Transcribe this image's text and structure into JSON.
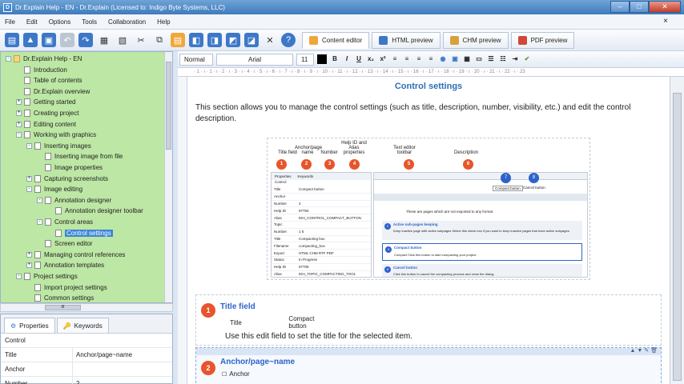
{
  "window": {
    "title": "Dr.Explain Help - EN - Dr.Explain (Licensed to: Indigo Byte Systems, LLC)",
    "buttons": {
      "minimize": "–",
      "maximize": "□",
      "close": "✕"
    }
  },
  "menu": {
    "items": [
      "File",
      "Edit",
      "Options",
      "Tools",
      "Collaboration",
      "Help"
    ],
    "close": "×"
  },
  "toolbar": {
    "tabs": [
      {
        "label": "Content editor",
        "active": true,
        "color": "#f0a73a"
      },
      {
        "label": "HTML preview",
        "active": false,
        "color": "#3d78c8"
      },
      {
        "label": "CHM preview",
        "active": false,
        "color": "#d9a13b"
      },
      {
        "label": "PDF preview",
        "active": false,
        "color": "#d1463a"
      }
    ],
    "help_label": "?"
  },
  "tree": {
    "items": [
      {
        "label": "Dr.Explain Help - EN",
        "level": 0,
        "expander": "-",
        "folder": true
      },
      {
        "label": "Introduction",
        "level": 1,
        "expander": "",
        "folder": false
      },
      {
        "label": "Table of contents",
        "level": 1,
        "expander": "",
        "folder": false
      },
      {
        "label": "Dr.Explain overview",
        "level": 1,
        "expander": "",
        "folder": false
      },
      {
        "label": "Getting started",
        "level": 1,
        "expander": "+",
        "folder": false
      },
      {
        "label": "Creating project",
        "level": 1,
        "expander": "+",
        "folder": false
      },
      {
        "label": "Editing content",
        "level": 1,
        "expander": "+",
        "folder": false
      },
      {
        "label": "Working with graphics",
        "level": 1,
        "expander": "-",
        "folder": false
      },
      {
        "label": "Inserting images",
        "level": 2,
        "expander": "-",
        "folder": false
      },
      {
        "label": "Inserting image from file",
        "level": 3,
        "expander": "",
        "folder": false
      },
      {
        "label": "Image properties",
        "level": 3,
        "expander": "",
        "folder": false
      },
      {
        "label": "Capturing screenshots",
        "level": 2,
        "expander": "+",
        "folder": false
      },
      {
        "label": "Image editing",
        "level": 2,
        "expander": "-",
        "folder": false
      },
      {
        "label": "Annotation designer",
        "level": 3,
        "expander": "-",
        "folder": false
      },
      {
        "label": "Annotation designer toolbar",
        "level": 4,
        "expander": "",
        "folder": false
      },
      {
        "label": "Control areas",
        "level": 3,
        "expander": "-",
        "folder": false
      },
      {
        "label": "Control settings",
        "level": 4,
        "expander": "",
        "folder": false,
        "selected": true
      },
      {
        "label": "Screen editor",
        "level": 3,
        "expander": "",
        "folder": false
      },
      {
        "label": "Managing control references",
        "level": 2,
        "expander": "+",
        "folder": false
      },
      {
        "label": "Annotation templates",
        "level": 2,
        "expander": "+",
        "folder": false
      },
      {
        "label": "Project settings",
        "level": 1,
        "expander": "-",
        "folder": false
      },
      {
        "label": "Import project settings",
        "level": 2,
        "expander": "",
        "folder": false
      },
      {
        "label": "Common settings",
        "level": 2,
        "expander": "",
        "folder": false
      }
    ],
    "hscroll_label": "III"
  },
  "properties": {
    "tabs": [
      "Properties",
      "Keywords"
    ],
    "section": "Control",
    "rows": [
      {
        "key": "Title",
        "value": "Anchor/page~name"
      },
      {
        "key": "Anchor",
        "value": ""
      },
      {
        "key": "Number",
        "value": "2"
      }
    ]
  },
  "format": {
    "style": "Normal",
    "font": "Arial",
    "size": "11",
    "buttons": [
      "B",
      "I",
      "U",
      "x₂",
      "x²"
    ]
  },
  "ruler_text": "· 1 · ı · 1 · ı · 2 · ı · 3 · ı · 4 · ı · 5 · ı · 6 · ı · 7 · ı · 8 · ı · 9 · ı · 10 · ı · 11 · ı · 12 · ı · 13 · ı · 14 · ı · 15 · ı · 16 · ı · 17 · ı · 18 · ı · 19 · ı · 20 · ı · 21 · ı · 22 · ı · 23",
  "content": {
    "heading": "Control settings",
    "intro": "This section allows you to manage the control settings (such as title, description, number, visibility, etc.) and edit the control description.",
    "figure": {
      "callouts": [
        {
          "num": "1",
          "label": "Title field"
        },
        {
          "num": "2",
          "label": "Anchor/page name"
        },
        {
          "num": "3",
          "label": "Number"
        },
        {
          "num": "4",
          "label": "Help ID and Alias properties"
        },
        {
          "num": "5",
          "label": "Text editor toolbar"
        },
        {
          "num": "6",
          "label": "Description"
        }
      ],
      "blue_callouts": [
        {
          "num": "7",
          "label": "Compact button"
        },
        {
          "num": "8",
          "label": "Cancel button"
        }
      ],
      "mini_rows": [
        {
          "k": "Title",
          "v": "Compact button"
        },
        {
          "k": "Anchor",
          "v": ""
        },
        {
          "k": "Number",
          "v": "4"
        },
        {
          "k": "Help ID",
          "v": "97784"
        },
        {
          "k": "Alias",
          "v": "IDH_CONTROL_COMPACT_BUTTON"
        },
        {
          "k": "Topic",
          "v": ""
        },
        {
          "k": "Number",
          "v": "1  5"
        },
        {
          "k": "Title",
          "v": "Compacting box"
        },
        {
          "k": "Filename",
          "v": "compacting_box"
        },
        {
          "k": "Export",
          "v": "HTML  CHM  RTF  PDF"
        },
        {
          "k": "Status",
          "v": "In Progress"
        },
        {
          "k": "Help ID",
          "v": "97706"
        },
        {
          "k": "Alias",
          "v": "IDH_TOPIC_COMPACTING_TOOL"
        }
      ],
      "mini_tabs": [
        "Properties",
        "Keywords"
      ],
      "mini_section": "Control",
      "right_lines": [
        "These are pages which are not exported to any format.",
        "Active sub-pages keeping",
        "Keep inactive page with active subpages   Select this check box if you want to keep inactive pages that have active subpages",
        "Compact button",
        "Compact   Click this button to start compacting your project.",
        "Cancel button",
        "Click this button to cancel the compacting process and close the dialog."
      ],
      "right_nums": [
        "2",
        "4",
        "5"
      ]
    },
    "section1": {
      "num": "1",
      "title": "Title field",
      "field_label": "Title",
      "field_value": "Compact button",
      "desc": "Use this edit field to set the title for the selected item."
    },
    "section2": {
      "num": "2",
      "title": "Anchor/page~name",
      "sub": "Anchor"
    }
  }
}
